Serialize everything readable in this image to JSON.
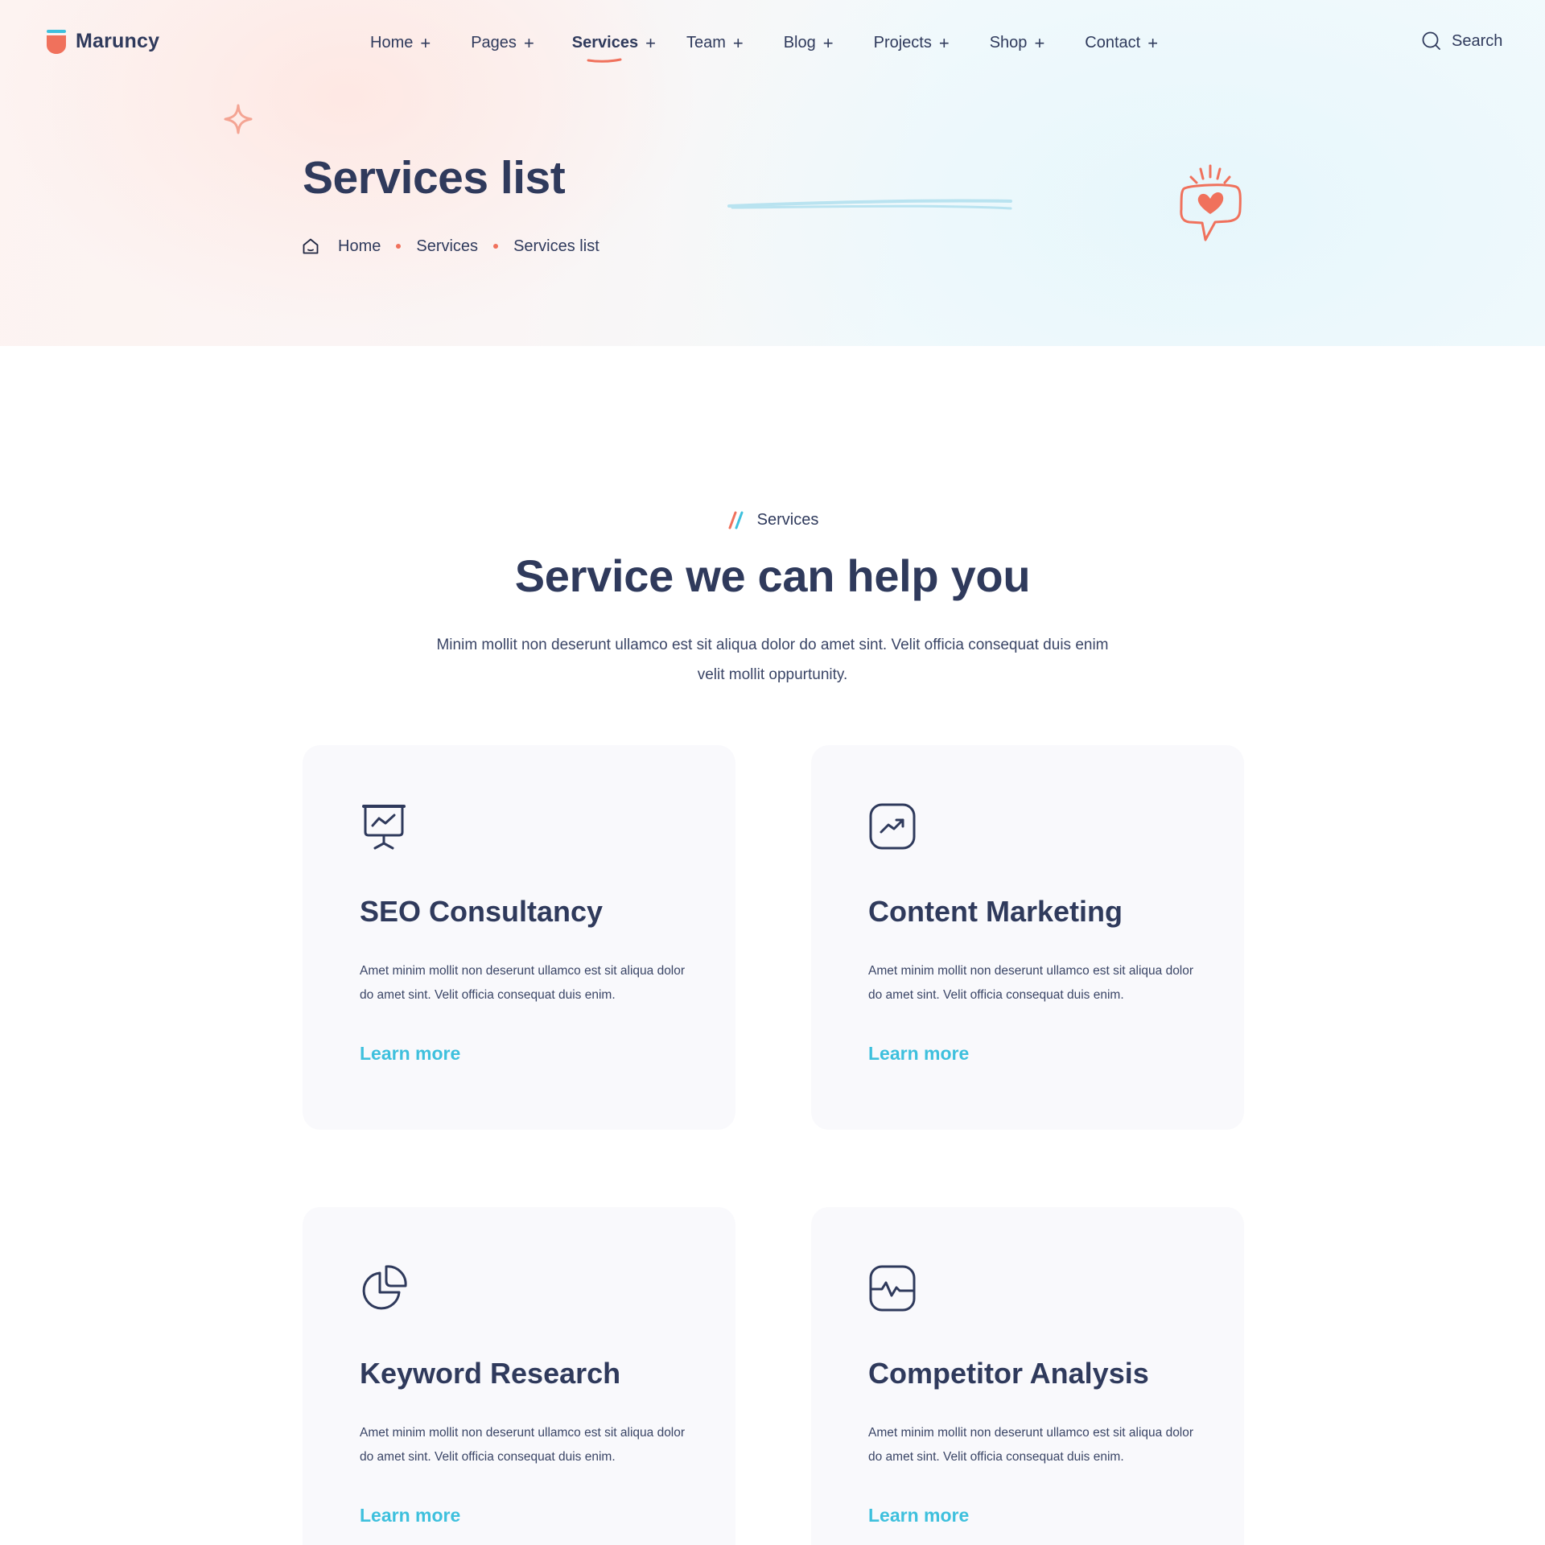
{
  "brand": {
    "name": "Maruncy"
  },
  "nav": {
    "items": [
      {
        "label": "Home",
        "active": false
      },
      {
        "label": "Pages",
        "active": false
      },
      {
        "label": "Services",
        "active": true
      },
      {
        "label": "Team",
        "active": false
      },
      {
        "label": "Blog",
        "active": false
      },
      {
        "label": "Projects",
        "active": false
      },
      {
        "label": "Shop",
        "active": false
      },
      {
        "label": "Contact",
        "active": false
      }
    ],
    "expand_symbol": "+"
  },
  "search": {
    "label": "Search",
    "icon": "search-icon"
  },
  "hero": {
    "title": "Services list",
    "breadcrumb": [
      "Home",
      "Services",
      "Services list"
    ]
  },
  "section": {
    "tag": "Services",
    "title": "Service we can help you",
    "description": "Minim mollit non deserunt ullamco est sit aliqua dolor do amet sint. Velit officia consequat duis enim velit mollit oppurtunity."
  },
  "services": [
    {
      "icon": "presentation-chart-icon",
      "title": "SEO Consultancy",
      "text": "Amet minim mollit non deserunt ullamco est sit aliqua dolor do amet sint. Velit officia consequat duis enim.",
      "link": "Learn more"
    },
    {
      "icon": "trending-up-icon",
      "title": "Content Marketing",
      "text": "Amet minim mollit non deserunt ullamco est sit aliqua dolor do amet sint. Velit officia consequat duis enim.",
      "link": "Learn more"
    },
    {
      "icon": "pie-chart-icon",
      "title": "Keyword Research",
      "text": "Amet minim mollit non deserunt ullamco est sit aliqua dolor do amet sint. Velit officia consequat duis enim.",
      "link": "Learn more"
    },
    {
      "icon": "activity-icon",
      "title": "Competitor Analysis",
      "text": "Amet minim mollit non deserunt ullamco est sit aliqua dolor do amet sint. Velit officia consequat duis enim.",
      "link": "Learn more"
    }
  ],
  "colors": {
    "primary_text": "#2f3a5c",
    "accent_coral": "#f0715c",
    "accent_cyan": "#3ec0dd",
    "card_bg": "#f9f9fc"
  }
}
